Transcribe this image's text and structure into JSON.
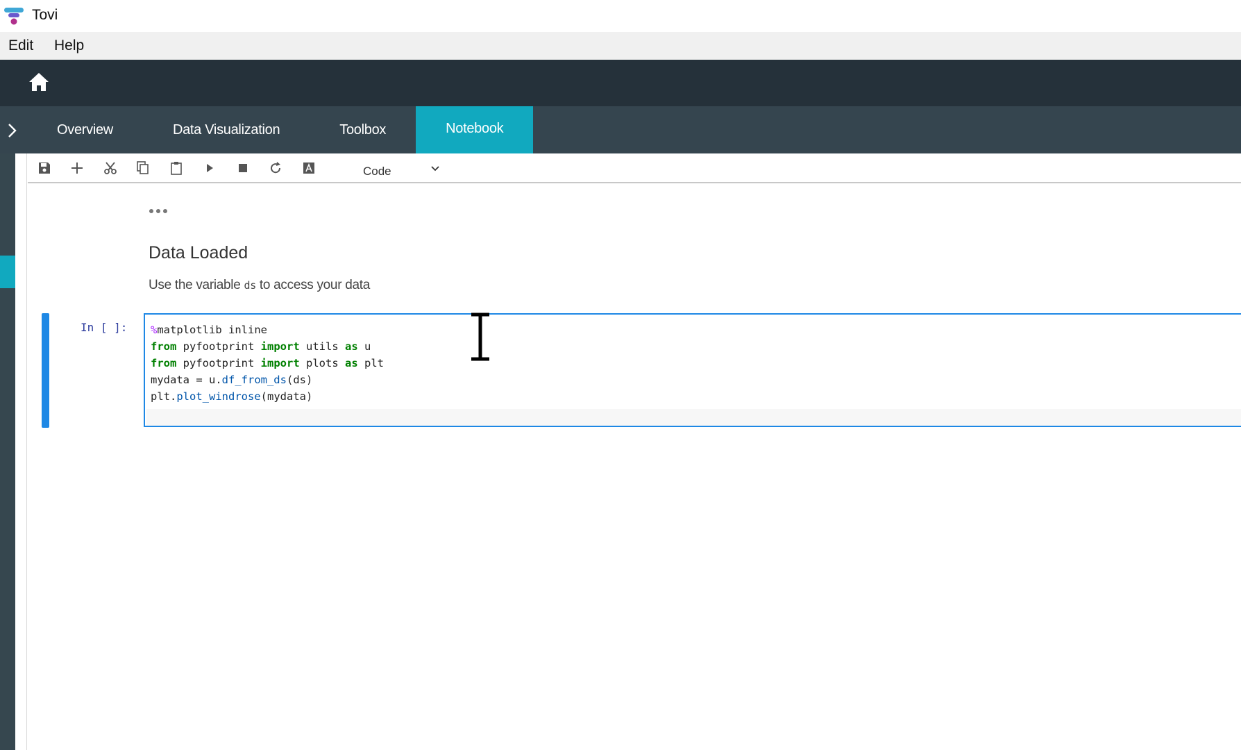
{
  "window": {
    "title": "Tovi"
  },
  "menu": {
    "items": [
      "Edit",
      "Help"
    ]
  },
  "tabs": [
    {
      "label": "Overview",
      "active": false
    },
    {
      "label": "Data Visualization",
      "active": false
    },
    {
      "label": "Toolbox",
      "active": false
    },
    {
      "label": "Notebook",
      "active": true
    }
  ],
  "toolbar": {
    "buttons": [
      "save-icon",
      "plus-icon",
      "scissors-icon",
      "copy-icon",
      "paste-icon",
      "play-icon",
      "stop-icon",
      "restart-icon",
      "keyboard-icon"
    ],
    "cell_type": "Code"
  },
  "notebook": {
    "output_heading": "Data Loaded",
    "output_text_before": "Use the variable ",
    "output_variable": "ds",
    "output_text_after": " to access your data",
    "cell_prompt": "In [ ]:",
    "code_lines": [
      "%matplotlib inline",
      "from pyfootprint import utils as u",
      "from pyfootprint import plots as plt",
      "mydata = u.df_from_ds(ds)",
      "plt.plot_windrose(mydata)"
    ]
  },
  "colors": {
    "header_bg": "#25313a",
    "tabbar_bg": "#35454f",
    "active_tab": "#11a9bf",
    "cell_border": "#1e88e5"
  }
}
